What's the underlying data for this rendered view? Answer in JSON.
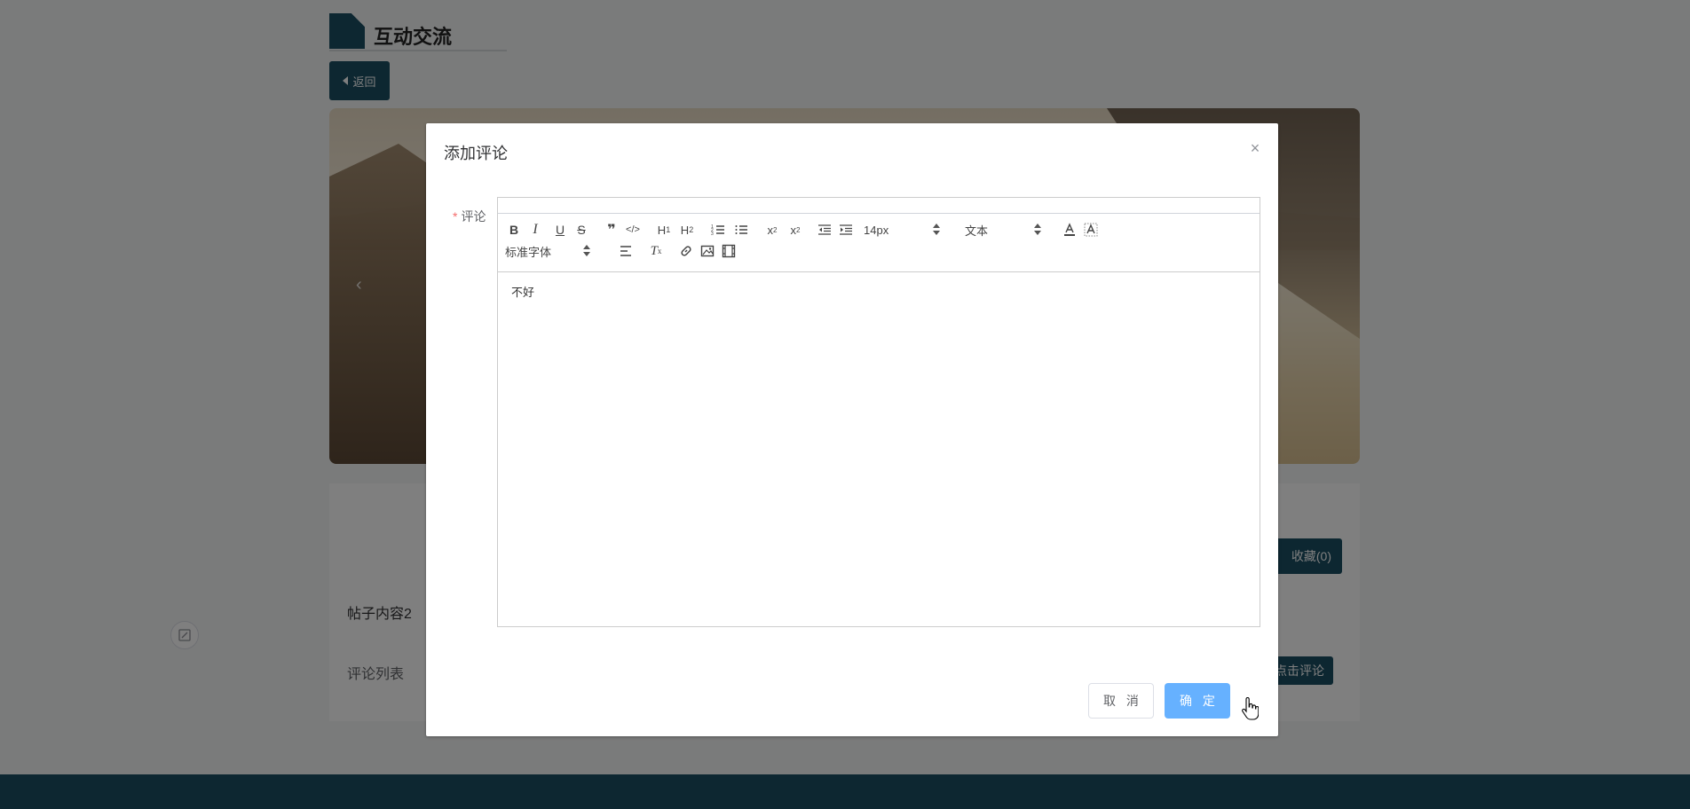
{
  "page": {
    "section_title": "互动交流",
    "back_label": "返回",
    "post_content": "帖子内容2",
    "comment_list_label": "评论列表",
    "favorite_label": "收藏(0)",
    "comment_button_label": "点击评论"
  },
  "dialog": {
    "title": "添加评论",
    "field_label": "评论",
    "toolbar": {
      "font_size_value": "14px",
      "header_value": "文本",
      "font_family_value": "标准字体"
    },
    "editor_text": "不好",
    "cancel_label": "取 消",
    "ok_label": "确 定"
  },
  "colors": {
    "primary_dark": "#1a4f63",
    "confirm_button": "#66b1ff",
    "required_star": "#f56c6c"
  }
}
